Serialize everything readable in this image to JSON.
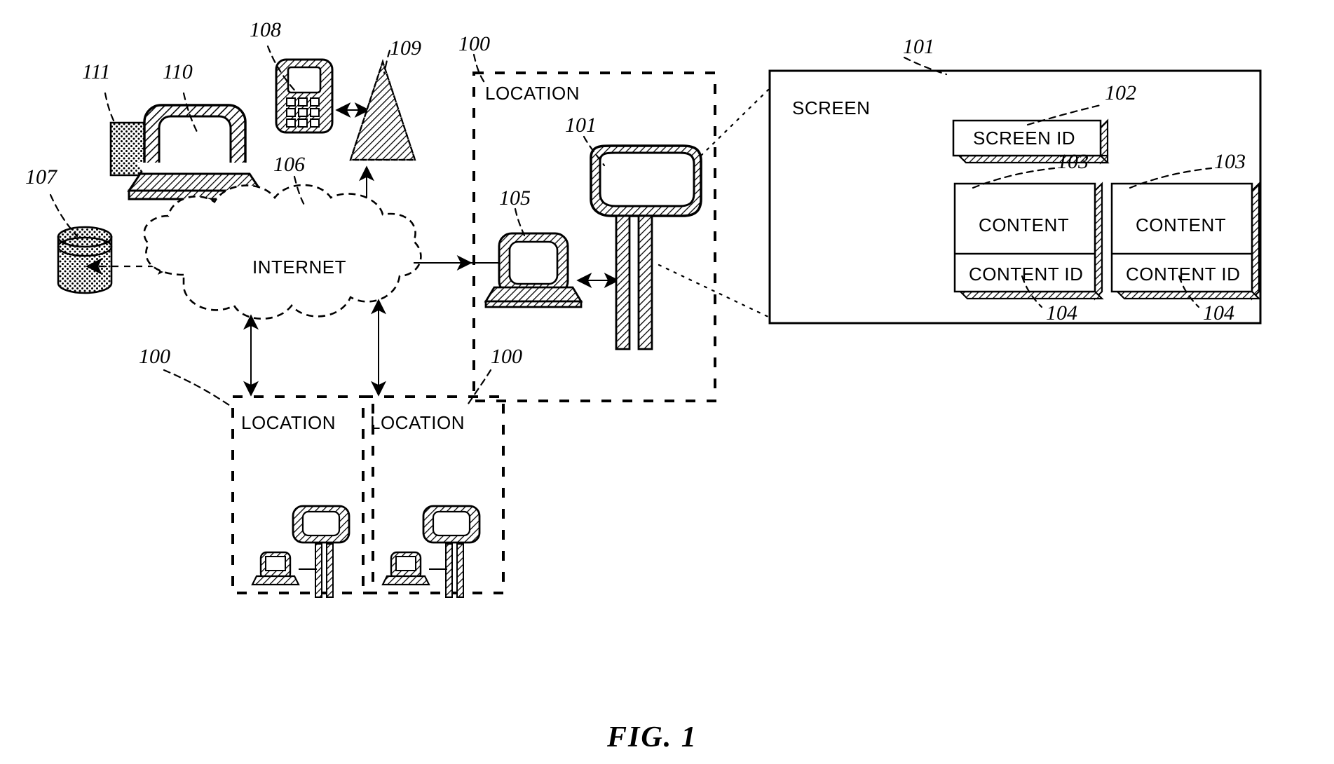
{
  "figure": {
    "caption": "FIG. 1",
    "title_refs": [
      "100",
      "101",
      "102",
      "103",
      "104",
      "105",
      "106",
      "107",
      "108",
      "109",
      "110",
      "111"
    ]
  },
  "reference_numerals": {
    "n100": "100",
    "n101": "101",
    "n102": "102",
    "n103": "103",
    "n104": "104",
    "n105": "105",
    "n106": "106",
    "n107": "107",
    "n108": "108",
    "n109": "109",
    "n110": "110",
    "n111": "111"
  },
  "nodes": {
    "internet_cloud": {
      "label": "INTERNET",
      "ref": "106"
    },
    "database": {
      "ref": "107",
      "name": "database-cylinder"
    },
    "admin_computer": {
      "ref": "110",
      "name": "admin-computer"
    },
    "admin_input": {
      "ref": "111",
      "name": "input-document"
    },
    "mobile_phone": {
      "ref": "108",
      "name": "mobile-phone"
    },
    "cell_tower": {
      "ref": "109",
      "name": "cell-tower-antenna"
    },
    "main_location": {
      "label": "LOCATION",
      "ref": "100"
    },
    "location_computer": {
      "ref": "105",
      "name": "location-computer"
    },
    "billboard_screen": {
      "ref": "101",
      "name": "billboard-screen"
    },
    "location_b": {
      "label": "LOCATION",
      "ref": "100"
    },
    "location_c": {
      "label": "LOCATION",
      "ref": "100"
    }
  },
  "detail_panel": {
    "title": "SCREEN",
    "ref": "101",
    "screen_id": {
      "label": "SCREEN ID",
      "ref": "102"
    },
    "content_blocks": [
      {
        "content_label": "CONTENT",
        "content_ref": "103",
        "id_label": "CONTENT ID",
        "id_ref": "104"
      },
      {
        "content_label": "CONTENT",
        "content_ref": "103",
        "id_label": "CONTENT ID",
        "id_ref": "104"
      }
    ]
  },
  "colors": {
    "ink": "#000000",
    "paper": "#ffffff"
  }
}
